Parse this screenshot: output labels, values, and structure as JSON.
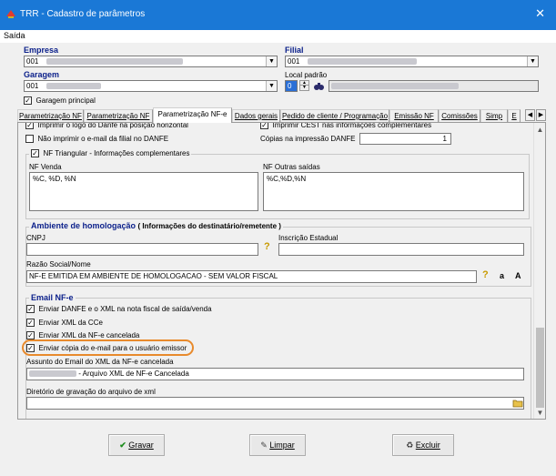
{
  "window": {
    "title": "TRR - Cadastro de parâmetros",
    "close_glyph": "✕"
  },
  "menu": {
    "saida": "Saída"
  },
  "header": {
    "empresa_label": "Empresa",
    "empresa_value": "001",
    "filial_label": "Filial",
    "filial_value": "001",
    "garagem_label": "Garagem",
    "garagem_value": "001",
    "local_padrao_label": "Local padrão",
    "local_padrao_value": "0",
    "garagem_principal_label": "Garagem principal",
    "garagem_principal_checked": true
  },
  "tabs": [
    {
      "label": "Parametrização NF",
      "active": false
    },
    {
      "label": "Parametrização NF",
      "active": false
    },
    {
      "label": "Parametrização NF-e",
      "active": true
    },
    {
      "label": "Dados gerais",
      "active": false
    },
    {
      "label": "Pedido de cliente / Programação",
      "active": false
    },
    {
      "label": "Emissão NF",
      "active": false
    },
    {
      "label": "Comissões",
      "active": false
    },
    {
      "label": "Simp",
      "active": false
    },
    {
      "label": "E",
      "active": false
    }
  ],
  "nfe": {
    "imprimir_opcao": "Imprimir o logo do Danfe na posição horizontal",
    "imprimir_cest": "Imprimir CEST nas informações complementares",
    "nao_imprimir_email": "Não imprimir o e-mail da filial no DANFE",
    "copias_label": "Cópias na impressão DANFE",
    "copias_value": "1",
    "nf_triangular_label": "NF Triangular - Informações complementares",
    "nf_venda_label": "NF Venda",
    "nf_venda_value": "%C, %D, %N",
    "nf_outras_label": "NF Outras saídas",
    "nf_outras_value": "%C,%D,%N"
  },
  "homologacao": {
    "title": "Ambiente de homologação",
    "subtitle": "( Informações do destinatário/remetente )",
    "cnpj_label": "CNPJ",
    "cnpj_value": "",
    "ie_label": "Inscrição Estadual",
    "ie_value": "",
    "razao_label": "Razão Social/Nome",
    "razao_value": "NF-E EMITIDA EM AMBIENTE DE HOMOLOGACAO - SEM VALOR FISCAL",
    "help_glyph": "?",
    "lower_a": "a",
    "upper_a": "A"
  },
  "email": {
    "title": "Email NF-e",
    "items": [
      {
        "label": "Enviar DANFE e o XML na nota fiscal de saída/venda",
        "checked": true
      },
      {
        "label": "Enviar XML da CCe",
        "checked": true
      },
      {
        "label": "Enviar XML da NF-e cancelada",
        "checked": true
      },
      {
        "label": "Enviar cópia do e-mail para o usuário emissor",
        "checked": true
      }
    ],
    "assunto_label": "Assunto do Email do XML da NF-e cancelada",
    "assunto_value": "- Arquivo XML de NF-e Cancelada",
    "diretorio_label": "Diretório de gravação do arquivo de xml",
    "diretorio_value": ""
  },
  "buttons": {
    "gravar": "Gravar",
    "limpar": "Limpar",
    "excluir": "Excluir"
  },
  "colors": {
    "titlebar": "#1a78d6",
    "label_blue": "#0a1f8a",
    "highlight": "#e88a2c"
  }
}
